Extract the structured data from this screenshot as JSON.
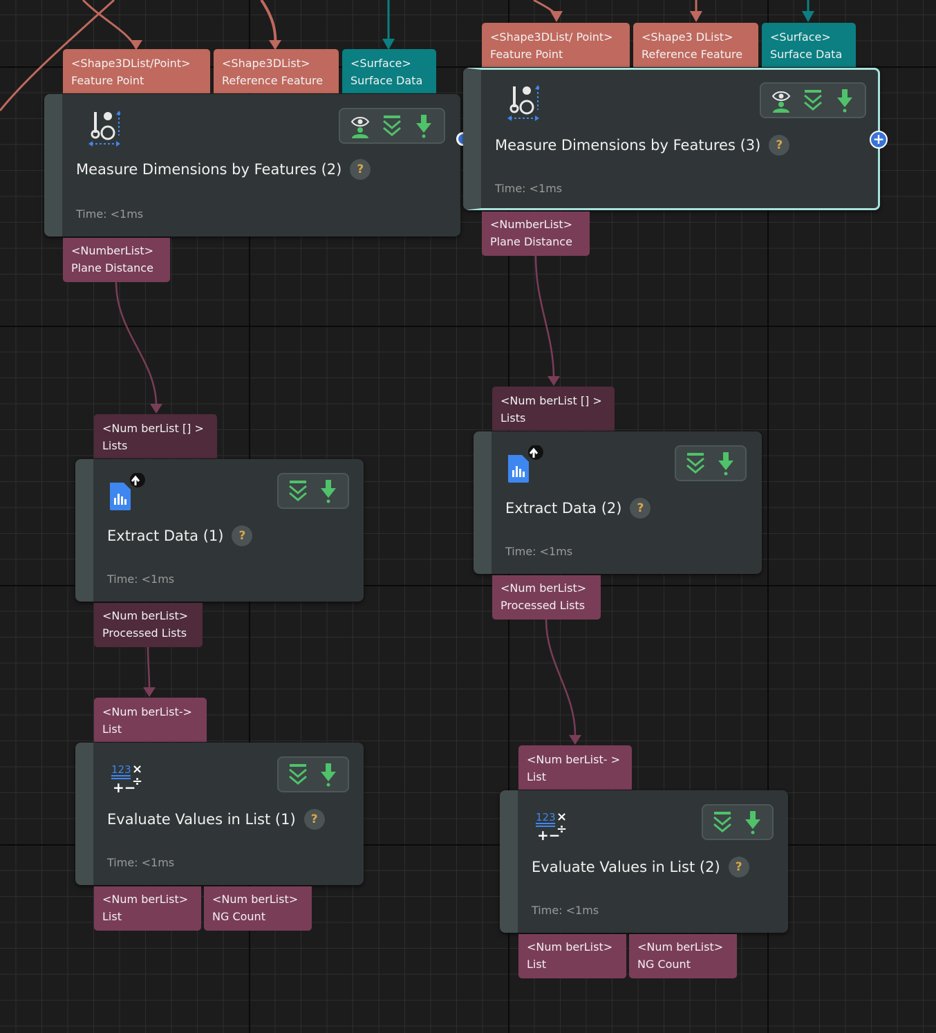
{
  "colors": {
    "shape_port": "#c0695e",
    "surface_port": "#0b7f82",
    "number_port": "#7a3d58",
    "number_port_inactive": "#4f2b3b",
    "node_body": "#303637",
    "selected_outline": "#a6e3dc",
    "help_icon": "#d9a845",
    "toolbar_green": "#4fc26a"
  },
  "measure2": {
    "inputs": [
      {
        "type": "<Shape3DList/Point>",
        "name": "Feature Point"
      },
      {
        "type": "<Shape3DList>",
        "name": "Reference Feature"
      },
      {
        "type": "<Surface>",
        "name": "Surface Data"
      }
    ],
    "icon": "measure-dimensions-icon",
    "title": "Measure Dimensions by Features (2)",
    "help": "?",
    "time": "Time: <1ms",
    "outputs": [
      {
        "type": "<NumberList>",
        "name": "Plane Distance"
      }
    ]
  },
  "measure3": {
    "inputs": [
      {
        "type": "<Shape3DList/ Point>",
        "name": "Feature Point"
      },
      {
        "type": "<Shape3 DList>",
        "name": "Reference Feature"
      },
      {
        "type": "<Surface>",
        "name": "Surface Data"
      }
    ],
    "icon": "measure-dimensions-icon",
    "title": "Measure Dimensions by Features (3)",
    "help": "?",
    "time": "Time: <1ms",
    "selected": true,
    "outputs": [
      {
        "type": "<NumberList>",
        "name": "Plane Distance"
      }
    ]
  },
  "extract1": {
    "inputs": [
      {
        "type": "<Num berList [] >",
        "name": "Lists"
      }
    ],
    "icon": "extract-data-icon",
    "title": "Extract Data (1)",
    "help": "?",
    "time": "Time: <1ms",
    "outputs": [
      {
        "type": "<Num berList>",
        "name": "Processed Lists"
      }
    ]
  },
  "extract2": {
    "inputs": [
      {
        "type": "<Num berList [] >",
        "name": "Lists"
      }
    ],
    "icon": "extract-data-icon",
    "title": "Extract Data (2)",
    "help": "?",
    "time": "Time: <1ms",
    "outputs": [
      {
        "type": "<Num berList>",
        "name": "Processed Lists"
      }
    ]
  },
  "evaluate1": {
    "inputs": [
      {
        "type": "<Num berList->",
        "name": "List"
      }
    ],
    "icon": "evaluate-values-icon",
    "title": "Evaluate Values in List (1)",
    "help": "?",
    "time": "Time: <1ms",
    "outputs": [
      {
        "type": "<Num berList>",
        "name": "List"
      },
      {
        "type": "<Num berList>",
        "name": "NG Count"
      }
    ]
  },
  "evaluate2": {
    "inputs": [
      {
        "type": "<Num berList- >",
        "name": "List"
      }
    ],
    "icon": "evaluate-values-icon",
    "title": "Evaluate Values in List (2)",
    "help": "?",
    "time": "Time: <1ms",
    "outputs": [
      {
        "type": "<Num berList>",
        "name": "List"
      },
      {
        "type": "<Num berList>",
        "name": "NG Count"
      }
    ]
  },
  "toolbar_icons": [
    "visualize-output-icon",
    "collapse-ports-icon",
    "execute-down-icon"
  ]
}
